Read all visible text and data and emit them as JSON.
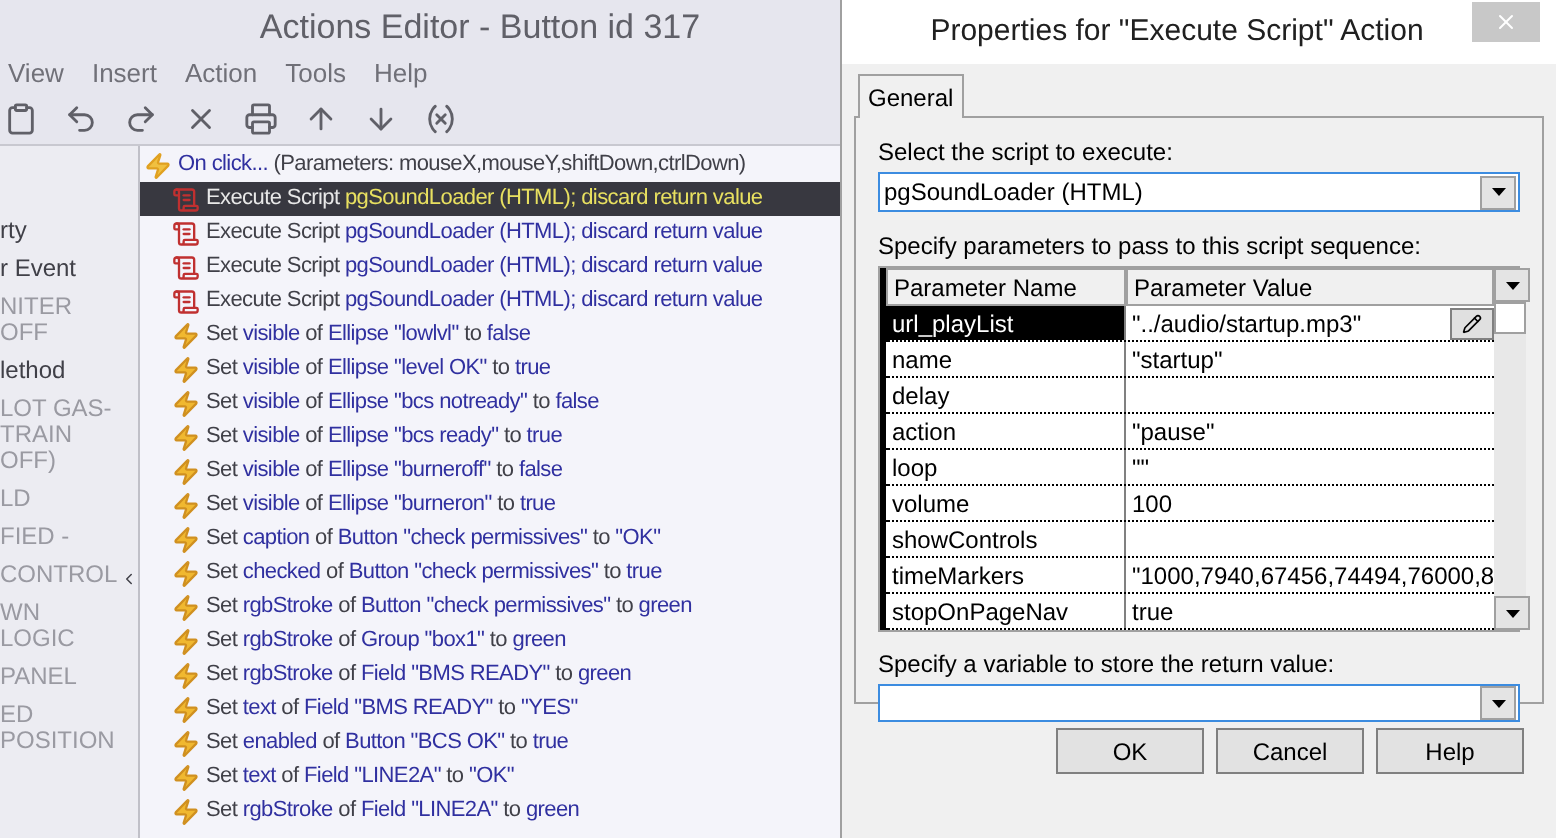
{
  "editor": {
    "title": "Actions Editor - Button id 317",
    "menu": [
      "View",
      "Insert",
      "Action",
      "Tools",
      "Help"
    ],
    "left_panel": [
      {
        "text": "rty",
        "faded": false
      },
      {
        "text": "r Event",
        "faded": false
      },
      {
        "text": "NITER OFF",
        "faded": true
      },
      {
        "text": "lethod",
        "faded": false
      },
      {
        "text": "LOT GAS-TRAIN OFF)",
        "faded": true
      },
      {
        "text": "LD",
        "faded": true
      },
      {
        "text": "FIED -",
        "faded": true
      },
      {
        "text": "CONTROL",
        "faded": true
      },
      {
        "text": "WN LOGIC",
        "faded": true
      },
      {
        "text": "PANEL",
        "faded": true
      },
      {
        "text": "ED POSITION",
        "faded": true
      }
    ],
    "actions": [
      {
        "kind": "event",
        "selected": false,
        "parts": [
          {
            "text": "On click...",
            "kind": "ref"
          },
          {
            "text": " (Parameters: mouseX,mouseY,shiftDown,ctrlDown)",
            "kind": "plain"
          }
        ]
      },
      {
        "kind": "script",
        "selected": true,
        "parts": [
          {
            "text": "Execute Script ",
            "kind": "plain"
          },
          {
            "text": "pgSoundLoader (HTML); discard return value",
            "kind": "ref"
          }
        ]
      },
      {
        "kind": "script",
        "selected": false,
        "parts": [
          {
            "text": "Execute Script ",
            "kind": "plain"
          },
          {
            "text": "pgSoundLoader (HTML); discard return value",
            "kind": "ref"
          }
        ]
      },
      {
        "kind": "script",
        "selected": false,
        "parts": [
          {
            "text": "Execute Script ",
            "kind": "plain"
          },
          {
            "text": "pgSoundLoader (HTML); discard return value",
            "kind": "ref"
          }
        ]
      },
      {
        "kind": "script",
        "selected": false,
        "parts": [
          {
            "text": "Execute Script ",
            "kind": "plain"
          },
          {
            "text": "pgSoundLoader (HTML); discard return value",
            "kind": "ref"
          }
        ]
      },
      {
        "kind": "set",
        "selected": false,
        "parts": [
          {
            "text": "Set ",
            "kind": "plain"
          },
          {
            "text": "visible",
            "kind": "ref"
          },
          {
            "text": " of ",
            "kind": "plain"
          },
          {
            "text": "Ellipse \"lowlvl\"",
            "kind": "ref"
          },
          {
            "text": " to ",
            "kind": "plain"
          },
          {
            "text": "false",
            "kind": "ref"
          }
        ]
      },
      {
        "kind": "set",
        "selected": false,
        "parts": [
          {
            "text": "Set ",
            "kind": "plain"
          },
          {
            "text": "visible",
            "kind": "ref"
          },
          {
            "text": " of ",
            "kind": "plain"
          },
          {
            "text": "Ellipse \"level OK\"",
            "kind": "ref"
          },
          {
            "text": " to ",
            "kind": "plain"
          },
          {
            "text": "true",
            "kind": "ref"
          }
        ]
      },
      {
        "kind": "set",
        "selected": false,
        "parts": [
          {
            "text": "Set ",
            "kind": "plain"
          },
          {
            "text": "visible",
            "kind": "ref"
          },
          {
            "text": " of ",
            "kind": "plain"
          },
          {
            "text": "Ellipse \"bcs notready\"",
            "kind": "ref"
          },
          {
            "text": " to ",
            "kind": "plain"
          },
          {
            "text": "false",
            "kind": "ref"
          }
        ]
      },
      {
        "kind": "set",
        "selected": false,
        "parts": [
          {
            "text": "Set ",
            "kind": "plain"
          },
          {
            "text": "visible",
            "kind": "ref"
          },
          {
            "text": " of ",
            "kind": "plain"
          },
          {
            "text": "Ellipse \"bcs ready\"",
            "kind": "ref"
          },
          {
            "text": " to ",
            "kind": "plain"
          },
          {
            "text": "true",
            "kind": "ref"
          }
        ]
      },
      {
        "kind": "set",
        "selected": false,
        "parts": [
          {
            "text": "Set ",
            "kind": "plain"
          },
          {
            "text": "visible",
            "kind": "ref"
          },
          {
            "text": " of ",
            "kind": "plain"
          },
          {
            "text": "Ellipse \"burneroff\"",
            "kind": "ref"
          },
          {
            "text": " to ",
            "kind": "plain"
          },
          {
            "text": "false",
            "kind": "ref"
          }
        ]
      },
      {
        "kind": "set",
        "selected": false,
        "parts": [
          {
            "text": "Set ",
            "kind": "plain"
          },
          {
            "text": "visible",
            "kind": "ref"
          },
          {
            "text": " of ",
            "kind": "plain"
          },
          {
            "text": "Ellipse \"burneron\"",
            "kind": "ref"
          },
          {
            "text": " to ",
            "kind": "plain"
          },
          {
            "text": "true",
            "kind": "ref"
          }
        ]
      },
      {
        "kind": "set",
        "selected": false,
        "parts": [
          {
            "text": "Set ",
            "kind": "plain"
          },
          {
            "text": "caption",
            "kind": "ref"
          },
          {
            "text": " of ",
            "kind": "plain"
          },
          {
            "text": "Button \"check permissives\"",
            "kind": "ref"
          },
          {
            "text": " to ",
            "kind": "plain"
          },
          {
            "text": "\"OK\"",
            "kind": "ref"
          }
        ]
      },
      {
        "kind": "set",
        "selected": false,
        "parts": [
          {
            "text": "Set ",
            "kind": "plain"
          },
          {
            "text": "checked",
            "kind": "ref"
          },
          {
            "text": " of ",
            "kind": "plain"
          },
          {
            "text": "Button \"check permissives\"",
            "kind": "ref"
          },
          {
            "text": " to ",
            "kind": "plain"
          },
          {
            "text": "true",
            "kind": "ref"
          }
        ]
      },
      {
        "kind": "set",
        "selected": false,
        "parts": [
          {
            "text": "Set ",
            "kind": "plain"
          },
          {
            "text": "rgbStroke",
            "kind": "ref"
          },
          {
            "text": " of ",
            "kind": "plain"
          },
          {
            "text": "Button \"check permissives\"",
            "kind": "ref"
          },
          {
            "text": " to ",
            "kind": "plain"
          },
          {
            "text": "green",
            "kind": "ref"
          }
        ]
      },
      {
        "kind": "set",
        "selected": false,
        "parts": [
          {
            "text": "Set ",
            "kind": "plain"
          },
          {
            "text": "rgbStroke",
            "kind": "ref"
          },
          {
            "text": " of ",
            "kind": "plain"
          },
          {
            "text": "Group \"box1\"",
            "kind": "ref"
          },
          {
            "text": " to ",
            "kind": "plain"
          },
          {
            "text": "green",
            "kind": "ref"
          }
        ]
      },
      {
        "kind": "set",
        "selected": false,
        "parts": [
          {
            "text": "Set ",
            "kind": "plain"
          },
          {
            "text": "rgbStroke",
            "kind": "ref"
          },
          {
            "text": " of ",
            "kind": "plain"
          },
          {
            "text": "Field \"BMS READY\"",
            "kind": "ref"
          },
          {
            "text": " to ",
            "kind": "plain"
          },
          {
            "text": "green",
            "kind": "ref"
          }
        ]
      },
      {
        "kind": "set",
        "selected": false,
        "parts": [
          {
            "text": "Set ",
            "kind": "plain"
          },
          {
            "text": "text",
            "kind": "ref"
          },
          {
            "text": " of ",
            "kind": "plain"
          },
          {
            "text": "Field \"BMS READY\"",
            "kind": "ref"
          },
          {
            "text": " to ",
            "kind": "plain"
          },
          {
            "text": "\"YES\"",
            "kind": "ref"
          }
        ]
      },
      {
        "kind": "set",
        "selected": false,
        "parts": [
          {
            "text": "Set ",
            "kind": "plain"
          },
          {
            "text": "enabled",
            "kind": "ref"
          },
          {
            "text": " of ",
            "kind": "plain"
          },
          {
            "text": "Button \"BCS OK\"",
            "kind": "ref"
          },
          {
            "text": " to ",
            "kind": "plain"
          },
          {
            "text": "true",
            "kind": "ref"
          }
        ]
      },
      {
        "kind": "set",
        "selected": false,
        "parts": [
          {
            "text": "Set ",
            "kind": "plain"
          },
          {
            "text": "text",
            "kind": "ref"
          },
          {
            "text": " of ",
            "kind": "plain"
          },
          {
            "text": "Field \"LINE2A\"",
            "kind": "ref"
          },
          {
            "text": " to ",
            "kind": "plain"
          },
          {
            "text": "\"OK\"",
            "kind": "ref"
          }
        ]
      },
      {
        "kind": "set",
        "selected": false,
        "parts": [
          {
            "text": "Set ",
            "kind": "plain"
          },
          {
            "text": "rgbStroke",
            "kind": "ref"
          },
          {
            "text": " of ",
            "kind": "plain"
          },
          {
            "text": "Field \"LINE2A\"",
            "kind": "ref"
          },
          {
            "text": " to ",
            "kind": "plain"
          },
          {
            "text": "green",
            "kind": "ref"
          }
        ]
      }
    ]
  },
  "dialog": {
    "title": "Properties for \"Execute Script\" Action",
    "tabs": [
      {
        "label": "General",
        "selected": true
      }
    ],
    "script_label": "Select the script to execute:",
    "script_value": "pgSoundLoader (HTML)",
    "params_label": "Specify parameters to pass to this script sequence:",
    "columns": [
      "Parameter Name",
      "Parameter Value"
    ],
    "rows": [
      {
        "name": "url_playList",
        "value": "\"../audio/startup.mp3\"",
        "selected": true
      },
      {
        "name": "name",
        "value": "\"startup\"",
        "selected": false
      },
      {
        "name": "delay",
        "selected": false
      },
      {
        "name": "action",
        "value": "\"pause\"",
        "selected": false
      },
      {
        "name": "loop",
        "value": "\"\"",
        "selected": false
      },
      {
        "name": "volume",
        "value": "100",
        "selected": false
      },
      {
        "name": "showControls",
        "selected": false
      },
      {
        "name": "timeMarkers",
        "value": "\"1000,7940,67456,74494,76000,8",
        "selected": false
      },
      {
        "name": "stopOnPageNav",
        "value": "true",
        "selected": false
      }
    ],
    "variable_label": "Specify a variable to store the return value:",
    "buttons": [
      "OK",
      "Cancel",
      "Help"
    ]
  }
}
